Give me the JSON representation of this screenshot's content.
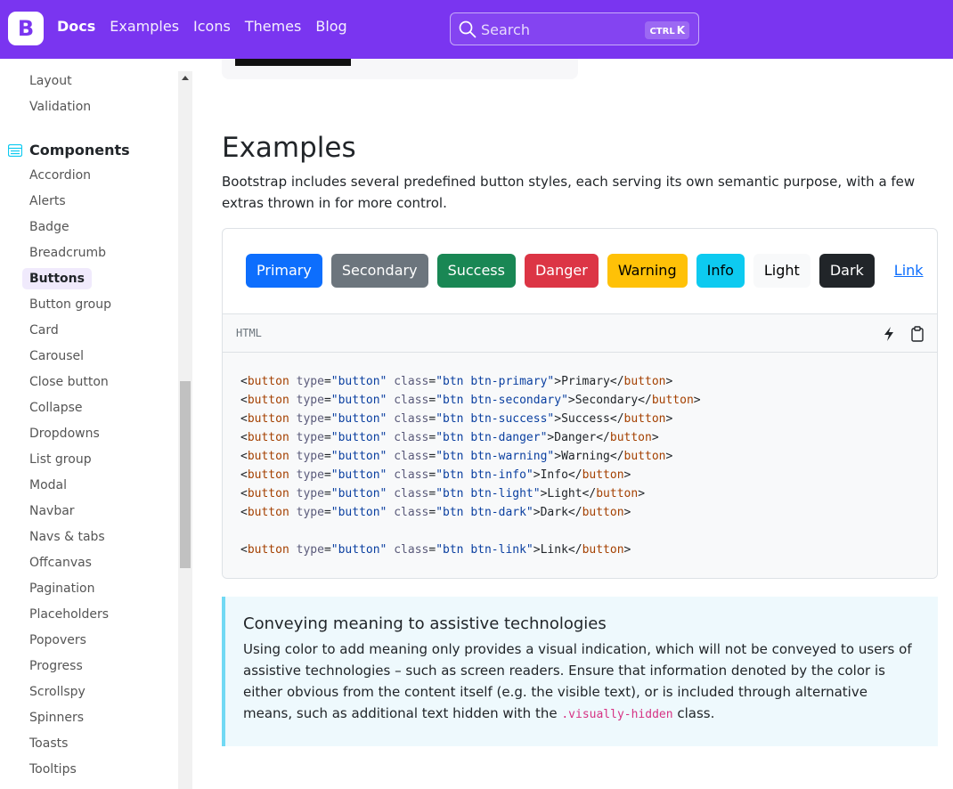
{
  "nav": {
    "brand": "B",
    "links": [
      "Docs",
      "Examples",
      "Icons",
      "Themes",
      "Blog"
    ],
    "search_placeholder": "Search",
    "search_kbd_ctrl": "CTRL",
    "search_kbd_key": "K"
  },
  "sidebar": {
    "top_items": [
      "Layout",
      "Validation"
    ],
    "section_title": "Components",
    "items": [
      "Accordion",
      "Alerts",
      "Badge",
      "Breadcrumb",
      "Buttons",
      "Button group",
      "Card",
      "Carousel",
      "Close button",
      "Collapse",
      "Dropdowns",
      "List group",
      "Modal",
      "Navbar",
      "Navs & tabs",
      "Offcanvas",
      "Pagination",
      "Placeholders",
      "Popovers",
      "Progress",
      "Scrollspy",
      "Spinners",
      "Toasts",
      "Tooltips"
    ],
    "active": "Buttons"
  },
  "main": {
    "title": "Examples",
    "lead": "Bootstrap includes several predefined button styles, each serving its own semantic purpose, with a few extras thrown in for more control.",
    "buttons": [
      {
        "label": "Primary",
        "bg": "#0d6efd",
        "fg": "#ffffff"
      },
      {
        "label": "Secondary",
        "bg": "#6c757d",
        "fg": "#ffffff"
      },
      {
        "label": "Success",
        "bg": "#198754",
        "fg": "#ffffff"
      },
      {
        "label": "Danger",
        "bg": "#dc3545",
        "fg": "#ffffff"
      },
      {
        "label": "Warning",
        "bg": "#ffc107",
        "fg": "#000000"
      },
      {
        "label": "Info",
        "bg": "#0dcaf0",
        "fg": "#000000"
      },
      {
        "label": "Light",
        "bg": "#f8f9fa",
        "fg": "#000000"
      },
      {
        "label": "Dark",
        "bg": "#212529",
        "fg": "#ffffff"
      }
    ],
    "link_button": "Link",
    "code_label": "HTML",
    "code_lines": [
      {
        "cls": "primary",
        "text": "Primary"
      },
      {
        "cls": "secondary",
        "text": "Secondary"
      },
      {
        "cls": "success",
        "text": "Success"
      },
      {
        "cls": "danger",
        "text": "Danger"
      },
      {
        "cls": "warning",
        "text": "Warning"
      },
      {
        "cls": "info",
        "text": "Info"
      },
      {
        "cls": "light",
        "text": "Light"
      },
      {
        "cls": "dark",
        "text": "Dark"
      },
      null,
      {
        "cls": "link",
        "text": "Link"
      }
    ],
    "callout": {
      "title": "Conveying meaning to assistive technologies",
      "body_before": "Using color to add meaning only provides a visual indication, which will not be conveyed to users of assistive technologies – such as screen readers. Ensure that information denoted by the color is either obvious from the content itself (e.g. the visible text), or is included through alternative means, such as additional text hidden with the ",
      "code": ".visually-hidden",
      "body_after": " class."
    }
  }
}
